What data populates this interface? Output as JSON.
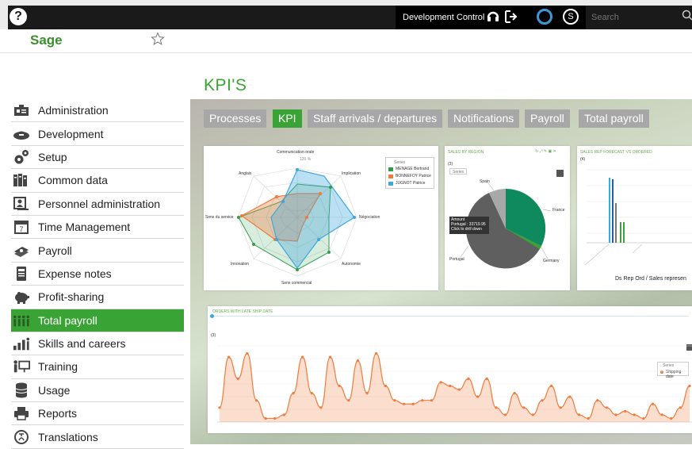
{
  "topbar": {
    "help_icon": "help-icon",
    "dev_control_label": "Development Control",
    "search_placeholder": "Search"
  },
  "brand": {
    "name": "Sage"
  },
  "page": {
    "title": "KPI'S"
  },
  "sidebar": {
    "items": [
      {
        "label": "Administration",
        "icon": "administration-icon"
      },
      {
        "label": "Development",
        "icon": "development-icon"
      },
      {
        "label": "Setup",
        "icon": "gears-icon"
      },
      {
        "label": "Common data",
        "icon": "books-icon"
      },
      {
        "label": "Personnel administration",
        "icon": "personnel-icon"
      },
      {
        "label": "Time Management",
        "icon": "calendar-icon"
      },
      {
        "label": "Payroll",
        "icon": "money-icon"
      },
      {
        "label": "Expense notes",
        "icon": "receipt-icon"
      },
      {
        "label": "Profit-sharing",
        "icon": "piggy-bank-icon"
      },
      {
        "label": "Total payroll",
        "icon": "people-icon",
        "active": true
      },
      {
        "label": "Skills and careers",
        "icon": "career-chart-icon"
      },
      {
        "label": "Training",
        "icon": "training-icon"
      },
      {
        "label": "Usage",
        "icon": "database-icon"
      },
      {
        "label": "Reports",
        "icon": "printer-icon"
      },
      {
        "label": "Translations",
        "icon": "translations-icon"
      }
    ]
  },
  "tabs": [
    {
      "label": "Processes"
    },
    {
      "label": "KPI",
      "active": true
    },
    {
      "label": "Staff arrivals / departures"
    },
    {
      "label": "Notifications"
    },
    {
      "label": "Payroll"
    },
    {
      "label": "Total payroll"
    }
  ],
  "widgets": {
    "radar": {
      "axes": [
        "Communication orale",
        "Implication",
        "Négociation",
        "Autonomie",
        "Sens commercial",
        "Innovation",
        "Sens du service",
        "Anglais"
      ],
      "scale_label": "120 %",
      "legend_title": "Series",
      "legend": [
        "MENAGE Bertrand",
        "BONNEFOY Patrice",
        "JUGNOT Patrice"
      ]
    },
    "pie": {
      "title": "SALES BY REGION",
      "legend_title": "Series",
      "slices": [
        "Spain",
        "France",
        "Germany",
        "Portugal"
      ],
      "tooltip": [
        "Amount",
        "Portugal : 33719.95",
        "Click to drill down"
      ],
      "counter": "(3)"
    },
    "bar": {
      "title": "SALES REP FORECAST VS ORDERED",
      "counter": "(4)",
      "caption": "Ds Rep Ord / Sales represen"
    },
    "line": {
      "title": "ORDERS WITH LATE SHIP DATE",
      "counter": "(3)",
      "legend_title": "Series",
      "legend_item": "Shipping date"
    }
  },
  "colors": {
    "brand_green": "#3aa335",
    "tab_gray": "#a7a7a7",
    "series_green": "#2e9d4b",
    "series_orange": "#ef7b3c",
    "series_blue": "#3ea7dd",
    "pie_green": "#0f8a5f",
    "pie_gray": "#7d7d7d",
    "pie_dark": "#5a5a5a"
  }
}
